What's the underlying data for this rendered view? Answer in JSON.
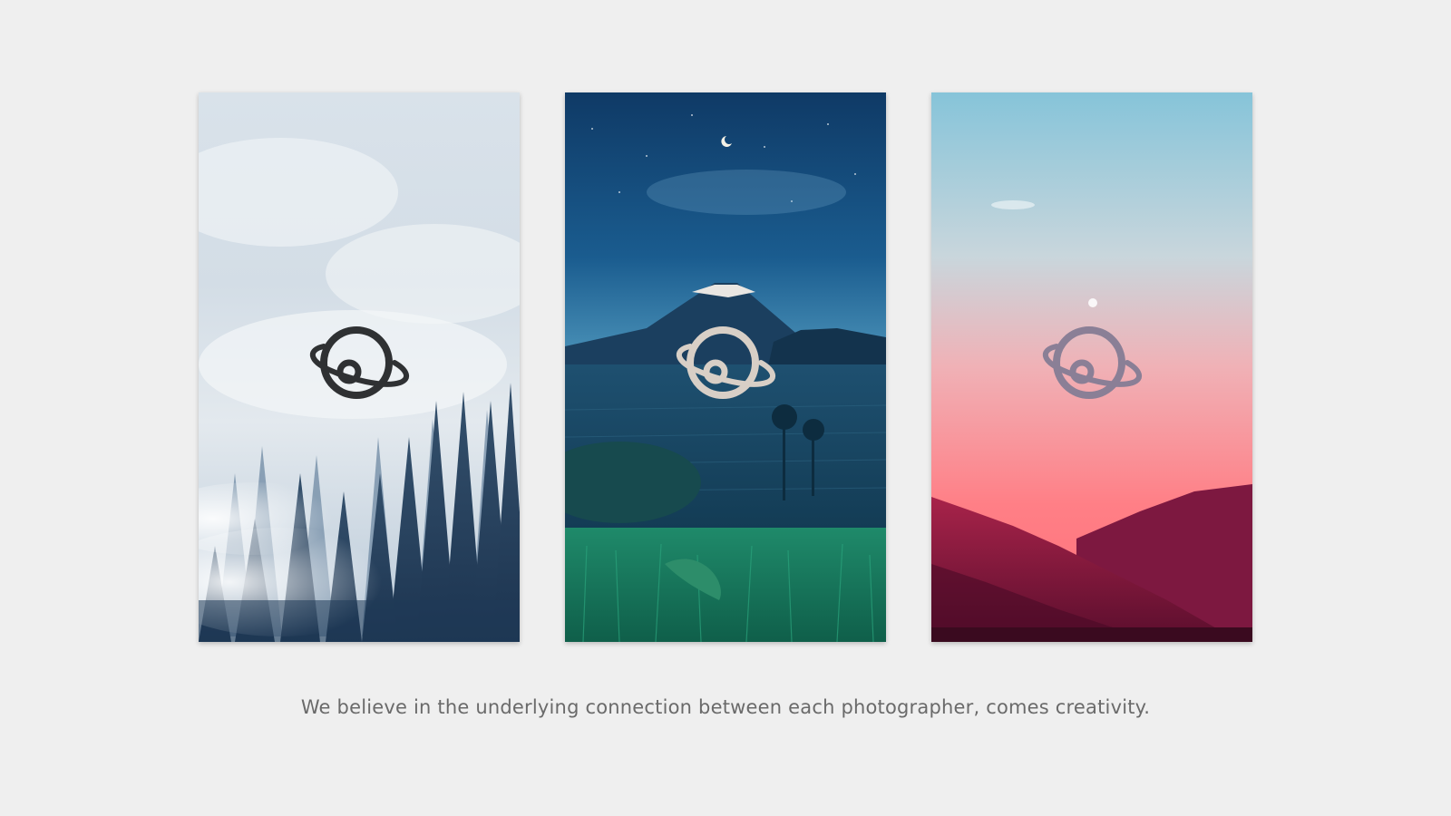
{
  "cards": [
    {
      "id": "forest",
      "logo_icon": "planet-icon",
      "logo_color": "#2f3133"
    },
    {
      "id": "volcano",
      "logo_icon": "planet-icon",
      "logo_color": "#d8cfc6"
    },
    {
      "id": "sunset",
      "logo_icon": "planet-icon",
      "logo_color": "#8a7f96"
    }
  ],
  "caption": "We believe in the underlying connection between each photographer, comes creativity."
}
